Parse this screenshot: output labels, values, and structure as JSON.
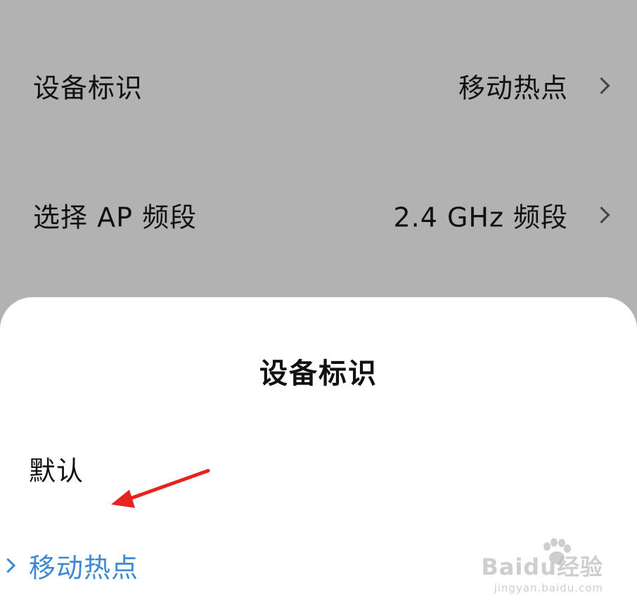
{
  "settings": {
    "rows": [
      {
        "label": "设备标识",
        "value": "移动热点"
      },
      {
        "label": "选择 AP 频段",
        "value": "2.4 GHz 频段"
      }
    ]
  },
  "sheet": {
    "title": "设备标识",
    "options": [
      {
        "label": "默认",
        "selected": false
      },
      {
        "label": "移动热点",
        "selected": true
      }
    ]
  },
  "watermark": {
    "logo": "Baidu经验",
    "url": "jingyan.baidu.com"
  },
  "colors": {
    "dim_overlay": "#b2b2b2",
    "accent": "#3c8ad6",
    "annotation_arrow": "#e8231f"
  }
}
